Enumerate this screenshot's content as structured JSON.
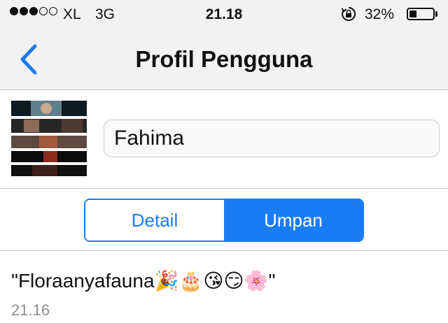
{
  "status_bar": {
    "signal_dots_filled": 3,
    "signal_dots_total": 5,
    "carrier": "XL",
    "network": "3G",
    "time": "21.18",
    "battery_percent_label": "32%",
    "battery_level": 0.32,
    "icons": [
      "signal-icon",
      "orientation-lock-icon",
      "battery-icon"
    ]
  },
  "nav": {
    "back_icon": "chevron-left-icon",
    "title": "Profil Pengguna"
  },
  "profile": {
    "avatar_icon": "avatar-image",
    "name_value": "Fahima"
  },
  "segments": {
    "items": [
      "Detail",
      "Umpan"
    ],
    "selected": "Umpan"
  },
  "feed": {
    "posts": [
      {
        "text": "\"Floraanyafauna🎉🎂😘😏🌸\"",
        "time": "21.16"
      }
    ]
  },
  "colors": {
    "accent": "#1a7cf5",
    "bar_background": "#f2f2f2",
    "separator": "#c8c8cc",
    "secondary_text": "#8e8e93"
  }
}
